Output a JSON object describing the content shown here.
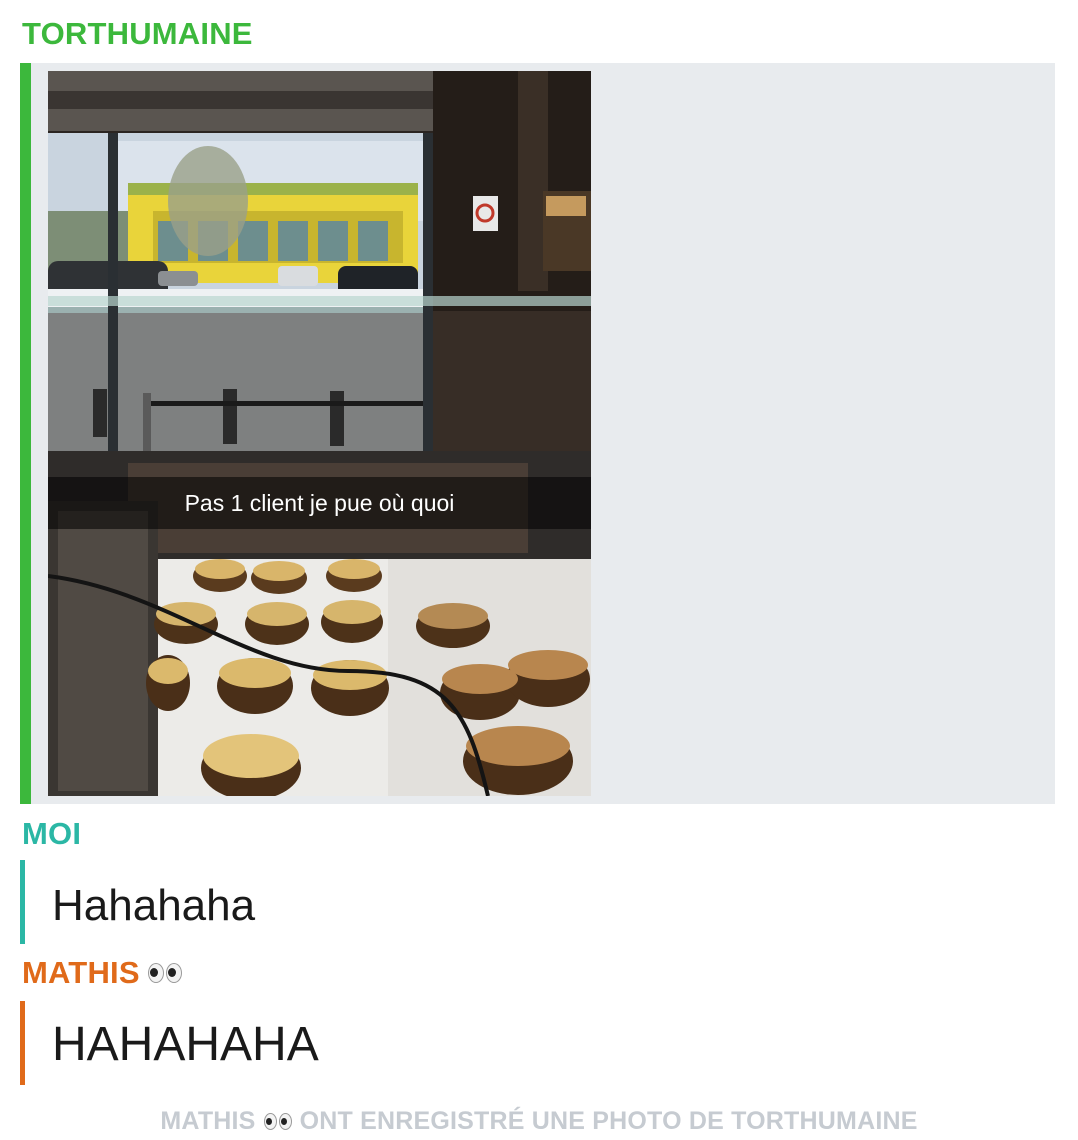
{
  "chat": {
    "messages": [
      {
        "sender": "TORTHUMAINE",
        "sender_color": "#3cb83c",
        "type": "snap_photo",
        "caption": "Pas 1 client je pue où quoi"
      },
      {
        "sender": "MOI",
        "sender_color": "#2bb7a5",
        "type": "text",
        "text": "Hahahaha"
      },
      {
        "sender": "MATHIS",
        "sender_color": "#e06a1a",
        "sender_icon": "eyes-emoji-icon",
        "type": "text",
        "text": "HAHAHAHA"
      }
    ],
    "save_notice": {
      "name": "MATHIS",
      "icon": "eyes-emoji-icon",
      "text": "ONT ENREGISTRÉ UNE PHOTO DE TORTHUMAINE"
    }
  },
  "colors": {
    "panel_bg": "#e8ebee",
    "notice_text": "#c6cbd1"
  }
}
